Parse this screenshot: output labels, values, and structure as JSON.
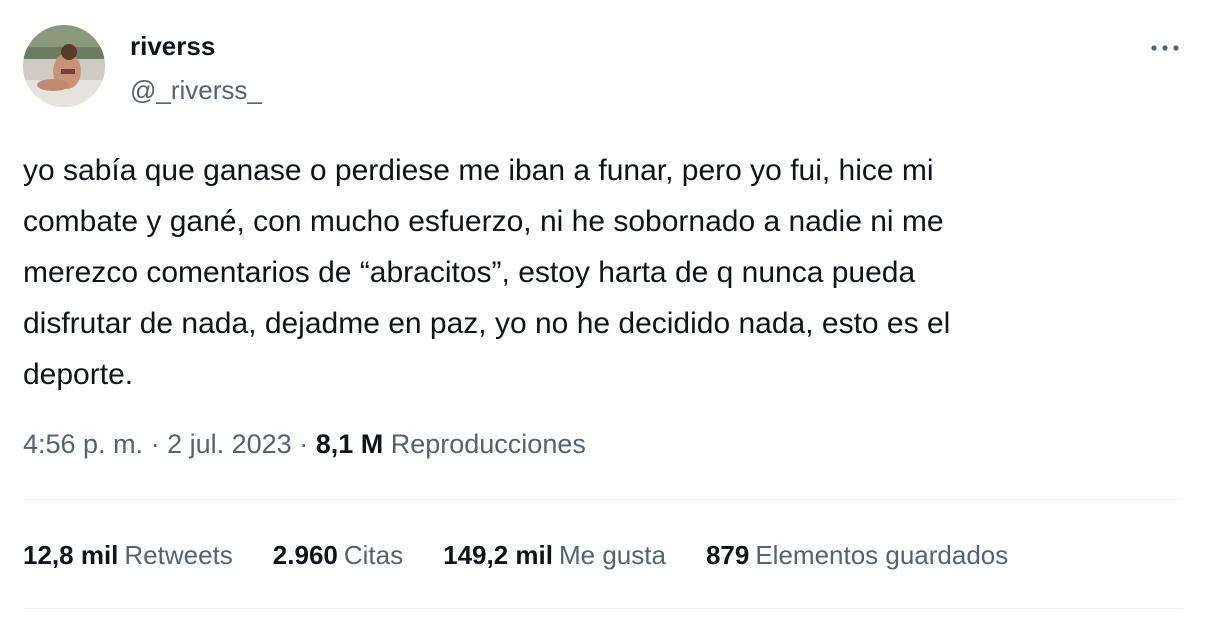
{
  "user": {
    "display_name": "riverss",
    "handle": "@_riverss_"
  },
  "tweet": {
    "text": "yo sabía que ganase o perdiese me iban a funar, pero yo fui, hice mi\ncombate y gané, con mucho esfuerzo, ni he sobornado a nadie ni me\nmerezco comentarios de “abracitos”, estoy harta de q nunca pueda\ndisfrutar de nada, dejadme en paz, yo no he decidido nada, esto es el\ndeporte."
  },
  "meta": {
    "time": "4:56 p. m.",
    "separator": " · ",
    "date": "2 jul. 2023",
    "views_count": "8,1 M",
    "views_label": "Reproducciones"
  },
  "stats": [
    {
      "count": "12,8 mil",
      "label": "Retweets"
    },
    {
      "count": "2.960",
      "label": "Citas"
    },
    {
      "count": "149,2 mil",
      "label": "Me gusta"
    },
    {
      "count": "879",
      "label": "Elementos guardados"
    }
  ],
  "icons": {
    "more": "more-horizontal-icon"
  },
  "colors": {
    "text_primary": "#0f1419",
    "text_secondary": "#536471",
    "divider": "#eff3f4"
  }
}
